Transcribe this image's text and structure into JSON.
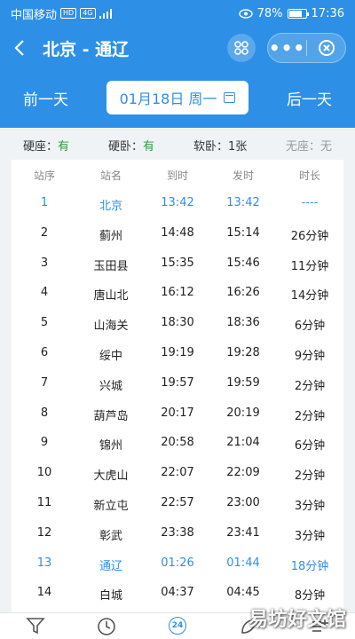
{
  "status_bar": {
    "carrier": "中国移动",
    "hd_tag": "HD",
    "net_tag": "4G",
    "battery": "78%",
    "time": "17:36"
  },
  "nav": {
    "title": "北京 - 通辽",
    "more_label": "•••"
  },
  "date_bar": {
    "prev_label": "前一天",
    "date_label": "01月18日 周一",
    "next_label": "后一天"
  },
  "seats": [
    {
      "label": "硬座：",
      "value": "有"
    },
    {
      "label": "硬卧：",
      "value": "有"
    },
    {
      "label": "软卧：",
      "value": "1张"
    },
    {
      "label": "无座：",
      "value": "无"
    }
  ],
  "table": {
    "headers": [
      "站序",
      "站名",
      "到时",
      "发时",
      "时长"
    ],
    "rows": [
      [
        "1",
        "北京",
        "13:42",
        "13:42",
        "----"
      ],
      [
        "2",
        "蓟州",
        "14:48",
        "15:14",
        "26分钟"
      ],
      [
        "3",
        "玉田县",
        "15:35",
        "15:46",
        "11分钟"
      ],
      [
        "4",
        "唐山北",
        "16:12",
        "16:26",
        "14分钟"
      ],
      [
        "5",
        "山海关",
        "18:30",
        "18:36",
        "6分钟"
      ],
      [
        "6",
        "绥中",
        "19:19",
        "19:28",
        "9分钟"
      ],
      [
        "7",
        "兴城",
        "19:57",
        "19:59",
        "2分钟"
      ],
      [
        "8",
        "葫芦岛",
        "20:17",
        "20:19",
        "2分钟"
      ],
      [
        "9",
        "锦州",
        "20:58",
        "21:04",
        "6分钟"
      ],
      [
        "10",
        "大虎山",
        "22:07",
        "22:09",
        "2分钟"
      ],
      [
        "11",
        "新立屯",
        "22:57",
        "23:00",
        "3分钟"
      ],
      [
        "12",
        "彰武",
        "23:38",
        "23:41",
        "3分钟"
      ],
      [
        "13",
        "通辽",
        "01:26",
        "01:44",
        "18分钟"
      ],
      [
        "14",
        "白城",
        "04:37",
        "04:45",
        "8分钟"
      ]
    ],
    "highlight_rows": [
      0,
      12
    ]
  },
  "tab_bar": {
    "center_tab_label": "24"
  },
  "watermark": "易坊好文馆",
  "colors": {
    "primary": "#2d90e6",
    "available": "#2a9d3c"
  }
}
